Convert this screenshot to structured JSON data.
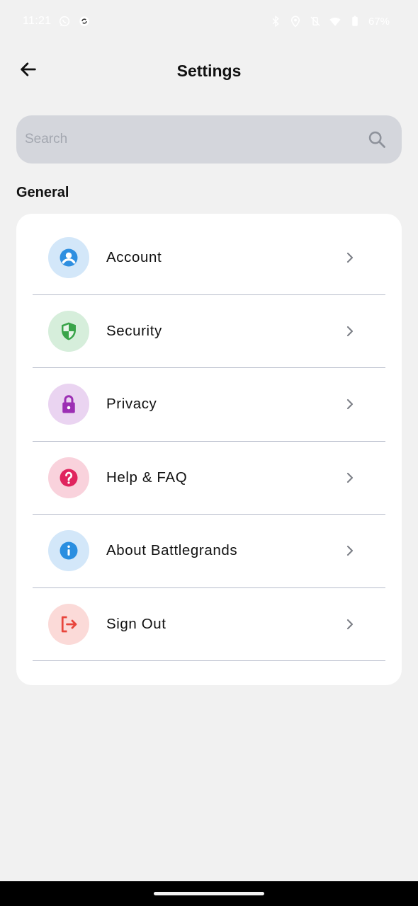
{
  "status_bar": {
    "time": "11:21",
    "battery": "67%",
    "icons": [
      "whatsapp-icon",
      "sync-icon",
      "bluetooth-icon",
      "location-icon",
      "vibrate-off-icon",
      "wifi-icon",
      "battery-icon"
    ]
  },
  "header": {
    "title": "Settings",
    "back_icon": "arrow-left-icon"
  },
  "search": {
    "placeholder": "Search",
    "value": "",
    "icon": "search-icon"
  },
  "section": {
    "label": "General"
  },
  "menu": {
    "items": [
      {
        "label": "Account",
        "icon": "account-icon",
        "icon_color": "#2f8fe0",
        "icon_bg": "#d3e7f9"
      },
      {
        "label": "Security",
        "icon": "shield-icon",
        "icon_color": "#3aa44a",
        "icon_bg": "#d6eedb"
      },
      {
        "label": "Privacy",
        "icon": "lock-icon",
        "icon_color": "#9c2fb4",
        "icon_bg": "#ead4f1"
      },
      {
        "label": "Help & FAQ",
        "icon": "help-icon",
        "icon_color": "#e0245e",
        "icon_bg": "#f9d2dc"
      },
      {
        "label": "About Battlegrands",
        "icon": "info-icon",
        "icon_color": "#2a8ee0",
        "icon_bg": "#d3e7f9"
      },
      {
        "label": "Sign Out",
        "icon": "sign-out-icon",
        "icon_color": "#e8453c",
        "icon_bg": "#fbdad8"
      }
    ]
  },
  "colors": {
    "background": "#f1f1f1",
    "card": "#ffffff",
    "search_bg": "#d4d6dc",
    "divider": "#b7bccb"
  }
}
